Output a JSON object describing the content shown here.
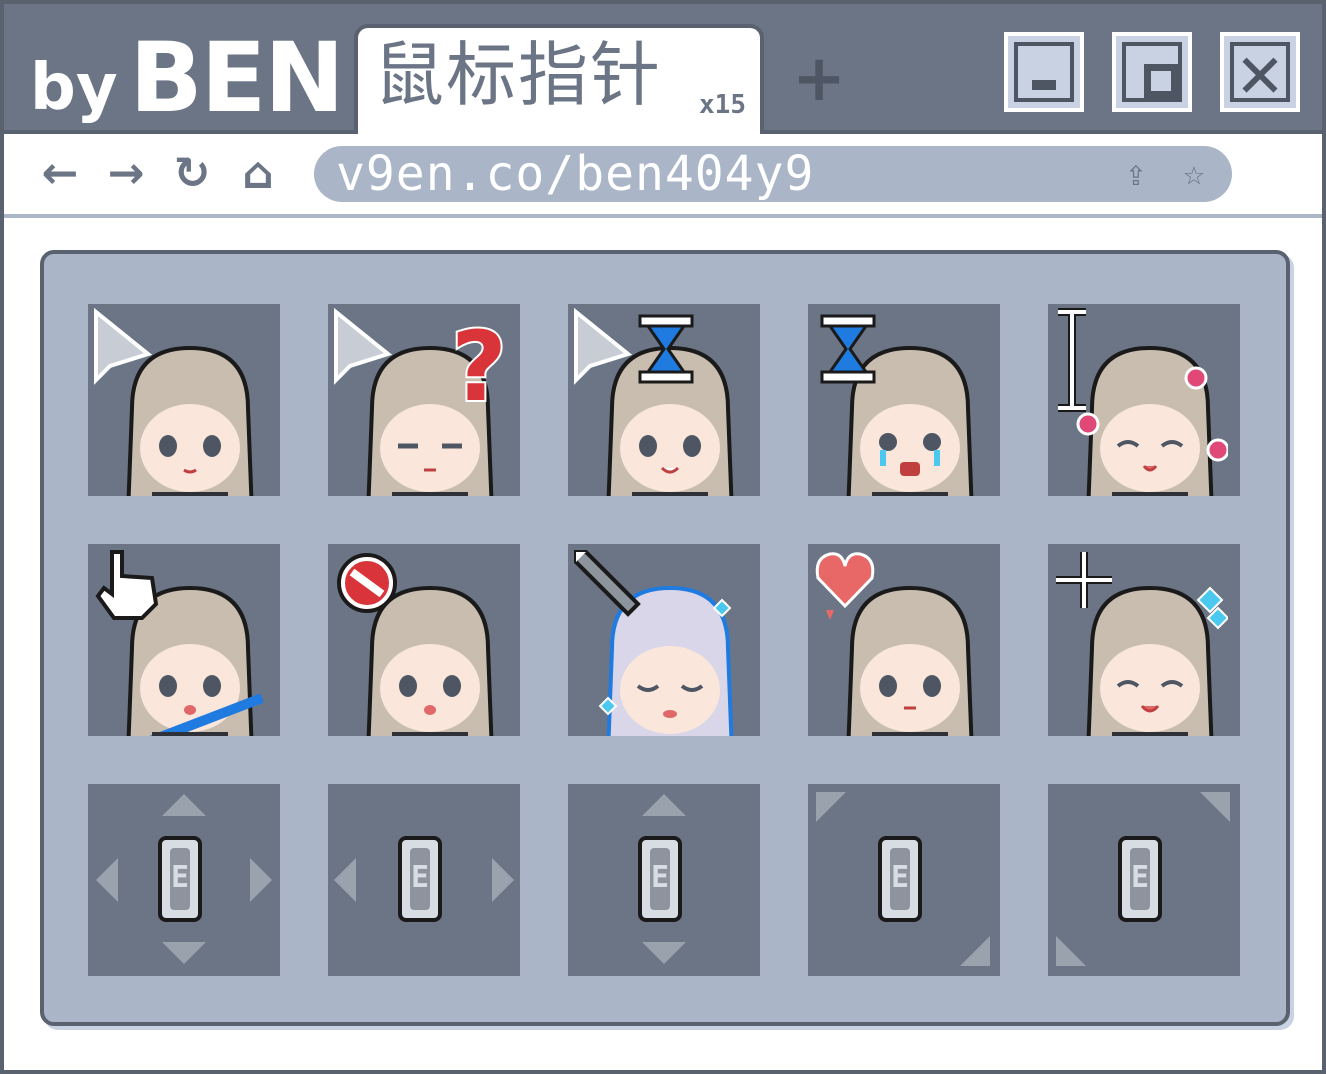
{
  "brand": {
    "by": "by",
    "name": "BEN"
  },
  "tab": {
    "label": "鼠标指针",
    "count": "x15"
  },
  "new_tab_label": "+",
  "window_controls": {
    "minimize_icon": "minimize-icon",
    "maximize_icon": "maximize-icon",
    "close_icon": "close-icon"
  },
  "navbar": {
    "back_glyph": "←",
    "forward_glyph": "→",
    "refresh_glyph": "↻",
    "home_glyph": "⌂",
    "url": "v9en.co/ben404y9",
    "share_glyph": "⇪",
    "star_glyph": "☆"
  },
  "colors": {
    "titlebar": "#6b7585",
    "panel": "#aab6c8",
    "cell": "#6b7585",
    "hair": "#c9bdb0",
    "skin": "#fbe6dc",
    "outline": "#1a1a1a",
    "accent_blue": "#1f7be0",
    "accent_red": "#d8343a",
    "accent_pink": "#e04878",
    "accent_cyan": "#4bc8f0"
  },
  "cursors": [
    {
      "name": "normal-select",
      "icon": "arrow-cursor-icon"
    },
    {
      "name": "help-select",
      "icon": "question-mark-icon"
    },
    {
      "name": "working-in-background",
      "icon": "hourglass-arrow-icon"
    },
    {
      "name": "busy",
      "icon": "hourglass-icon"
    },
    {
      "name": "text-select",
      "icon": "ibeam-icon"
    },
    {
      "name": "link-select",
      "icon": "hand-pointer-icon"
    },
    {
      "name": "unavailable",
      "icon": "no-entry-icon"
    },
    {
      "name": "handwriting",
      "icon": "pen-icon"
    },
    {
      "name": "alternate-select",
      "icon": "heart-icon"
    },
    {
      "name": "precision-select",
      "icon": "crosshair-icon"
    },
    {
      "name": "move",
      "icon": "move-arrows-icon",
      "letter": "E"
    },
    {
      "name": "horizontal-resize",
      "icon": "horizontal-arrows-icon",
      "letter": "E"
    },
    {
      "name": "vertical-resize",
      "icon": "vertical-arrows-icon",
      "letter": "E"
    },
    {
      "name": "diagonal-resize-1",
      "icon": "diagonal-nw-se-icon",
      "letter": "E"
    },
    {
      "name": "diagonal-resize-2",
      "icon": "diagonal-ne-sw-icon",
      "letter": "E"
    }
  ]
}
